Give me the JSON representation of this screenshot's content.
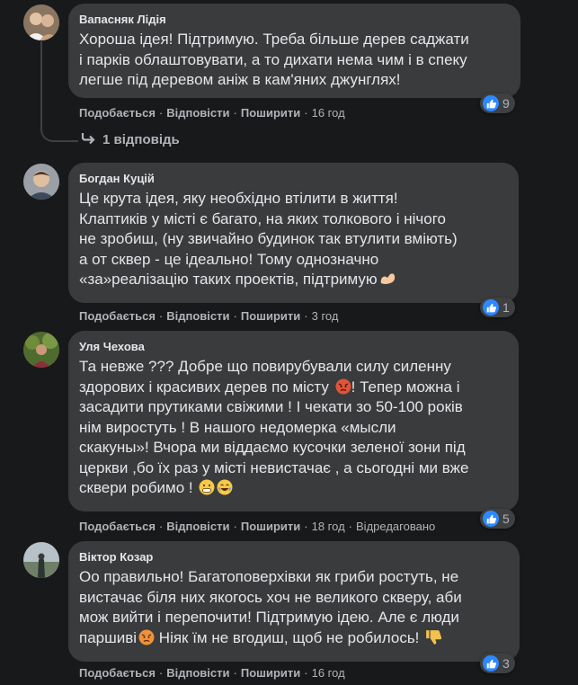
{
  "comments": [
    {
      "author": "Вапасняк Лідія",
      "text": "Хороша ідея! Підтримую. Треба більше дерев саджати\nі парків облаштовувати, а то дихати нема чим і в спеку\nлегше під деревом аніж в кам'яних джунглях!",
      "like": "Подобається",
      "reply": "Відповісти",
      "share": "Поширити",
      "time": "16 год",
      "reactions": "9"
    },
    {
      "author": "Богдан Куцій",
      "text": "Це крута ідея, яку необхідно втілити в життя!\nКлаптиків у місті є багато, на яких толкового і нічого\nне зробиш, (ну звичайно будинок так втулити вміють)\nа от сквер - це ідеально! Тому однозначно\n«за»реалізацію таких проектів, підтримую",
      "like": "Подобається",
      "reply": "Відповісти",
      "share": "Поширити",
      "time": "3 год",
      "reactions": "1"
    },
    {
      "author": "Уля Чехова",
      "text_lines": [
        "Та невже ??? Добре що повирубували силу силенну",
        "здорових і красивих дерев по місту ",
        "! Тепер можна і",
        "засадити прутиками свіжими ! І чекати зо 50-100 років",
        "нім виростуть ! В нашого недомерка «мысли",
        "скакуны»! Вчора ми віддаємо кусочки зеленої зони під",
        "церкви ,бо їх раз у місті невистачає , а сьогодні ми вже",
        "сквери робимо ! "
      ],
      "like": "Подобається",
      "reply": "Відповісти",
      "share": "Поширити",
      "time": "18 год",
      "edited": "Відредаговано",
      "reactions": "5"
    },
    {
      "author": "Віктор Козар",
      "text_lines": [
        "Оо правильно! Багатоповерхівки як гриби ростуть, не",
        "вистачає біля них якогось хоч не великого скверу, аби",
        "мож вийти і перепочити! Підтримую ідею. Але є люди",
        "паршиві",
        " Ніяк їм не вгодиш, щоб не робилось! "
      ],
      "like": "Подобається",
      "reply": "Відповісти",
      "share": "Поширити",
      "time": "16 год",
      "reactions": "3"
    }
  ],
  "thread": {
    "replies_label": "1 відповідь"
  },
  "icons": {
    "like": "thumbs-up-icon",
    "reply_arrow": "reply-arrow-icon"
  },
  "colors": {
    "like_blue": "#2d88ff",
    "bubble": "#3a3b3c",
    "background": "#18191a"
  }
}
